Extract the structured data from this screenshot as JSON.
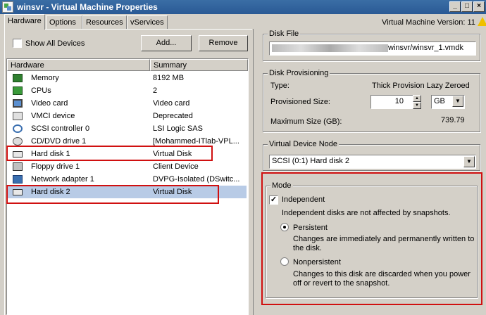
{
  "window": {
    "title": "winsvr - Virtual Machine Properties",
    "controls": [
      "_",
      "□",
      "×"
    ]
  },
  "tabs": [
    "Hardware",
    "Options",
    "Resources",
    "vServices"
  ],
  "version_label": "Virtual Machine Version: 11",
  "left": {
    "show_all_label": "Show All Devices",
    "add_label": "Add...",
    "remove_label": "Remove",
    "columns": [
      "Hardware",
      "Summary"
    ],
    "rows": [
      {
        "icon": "memory-icon",
        "name": "Memory",
        "summary": "8192 MB"
      },
      {
        "icon": "cpu-icon",
        "name": "CPUs",
        "summary": "2"
      },
      {
        "icon": "video-card-icon",
        "name": "Video card",
        "summary": "Video card"
      },
      {
        "icon": "vmci-device-icon",
        "name": "VMCI device",
        "summary": "Deprecated"
      },
      {
        "icon": "scsi-controller-icon",
        "name": "SCSI controller 0",
        "summary": "LSI Logic SAS"
      },
      {
        "icon": "cd-dvd-icon",
        "name": "CD/DVD drive 1",
        "summary": "[Mohammed-ITlab-VPL..."
      },
      {
        "icon": "hard-disk-icon",
        "name": "Hard disk 1",
        "summary": "Virtual Disk"
      },
      {
        "icon": "floppy-icon",
        "name": "Floppy drive 1",
        "summary": "Client Device"
      },
      {
        "icon": "network-adapter-icon",
        "name": "Network adapter 1",
        "summary": "DVPG-Isolated (DSwitc..."
      },
      {
        "icon": "hard-disk-icon",
        "name": "Hard disk 2",
        "summary": "Virtual Disk"
      }
    ]
  },
  "disk_file": {
    "title": "Disk File",
    "path_visible": "winsvr/winsvr_1.vmdk"
  },
  "provisioning": {
    "title": "Disk Provisioning",
    "type_label": "Type:",
    "type_value": "Thick Provision Lazy Zeroed",
    "size_label": "Provisioned Size:",
    "size_value": "10",
    "size_unit": "GB",
    "max_label": "Maximum Size (GB):",
    "max_value": "739.79"
  },
  "device_node": {
    "title": "Virtual Device Node",
    "value": "SCSI (0:1) Hard disk 2"
  },
  "mode": {
    "title": "Mode",
    "independent_label": "Independent",
    "independent_desc": "Independent disks are not affected by snapshots.",
    "persistent_label": "Persistent",
    "persistent_desc": "Changes are immediately and permanently written to the disk.",
    "nonpersistent_label": "Nonpersistent",
    "nonpersistent_desc": "Changes to this disk are discarded when you power off or revert to the snapshot."
  },
  "colors": {
    "highlight": "#d01010",
    "selection": "#b8cbe6",
    "titlebar": "#2a5a95"
  }
}
